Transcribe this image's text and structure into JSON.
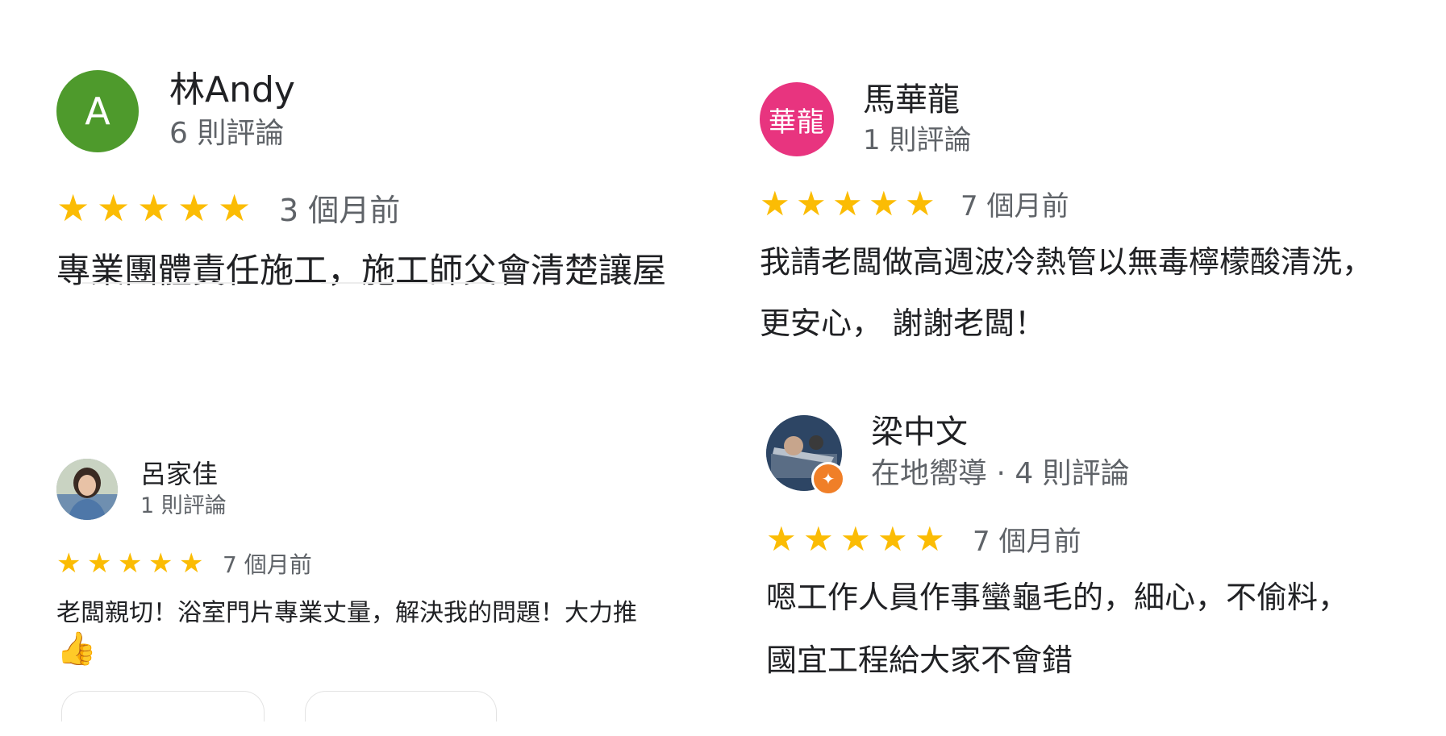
{
  "reviews": [
    {
      "reviewer": "林Andy",
      "avatar_letter": "A",
      "avatar_color": "#4e9a2c",
      "meta": "6 則評論",
      "rating": 5,
      "time": "3 個月前",
      "text_lines": [
        "專業團體責任施工，施工師父會清楚讓屋"
      ]
    },
    {
      "reviewer": "馬華龍",
      "avatar_letter": "華龍",
      "avatar_color": "#e8347f",
      "meta": "1 則評論",
      "rating": 5,
      "time": "7 個月前",
      "text_lines": [
        "我請老闆做高週波冷熱管以無毒檸檬酸清洗，",
        "更安心， 謝謝老闆！"
      ]
    },
    {
      "reviewer": "呂家佳",
      "avatar_icon": "profile-photo",
      "meta": "1 則評論",
      "rating": 5,
      "time": "7 個月前",
      "text_lines": [
        "老闆親切！浴室門片專業丈量，解決我的問題！大力推",
        "👍"
      ]
    },
    {
      "reviewer": "梁中文",
      "avatar_icon": "profile-photo",
      "badge_icon": "local-guide-star-icon",
      "badge_color": "#f07f28",
      "meta": "在地嚮導 · 4 則評論",
      "rating": 5,
      "time": "7 個月前",
      "text_lines": [
        "嗯工作人員作事蠻龜毛的，細心，不偷料，",
        "國宜工程給大家不會錯"
      ]
    }
  ],
  "star_color": "#fbbc04"
}
